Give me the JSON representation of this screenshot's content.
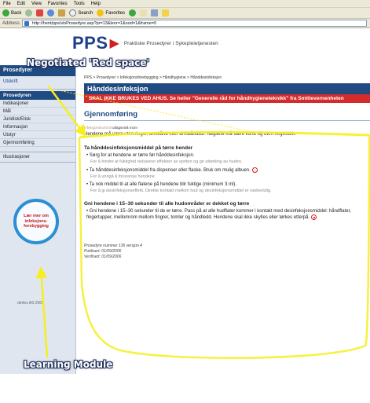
{
  "browser": {
    "menu": [
      "File",
      "Edit",
      "View",
      "Favorites",
      "Tools",
      "Help"
    ],
    "toolbar": {
      "back": "Back",
      "search": "Search",
      "favorites": "Favorites"
    },
    "address_label": "Address",
    "url": "http://hent/pps/visProsedyre.asp?pr=13&lenr=1&nod=1&frame=0"
  },
  "logo": {
    "mark": "PPS",
    "tagline": "Praktiske Prosedyrer i Sykepleietjenesten"
  },
  "sidebar": {
    "heading": "Prosedyrer",
    "print_link": "Utskrift",
    "selected": "Prosedyren",
    "items": [
      "Indikasjoner",
      "Mål",
      "Juridisk/Etisk",
      "Informasjon",
      "Utstyr",
      "Gjennomføring"
    ],
    "illustrations": "Illustrasjoner",
    "learning_circle": "Lær mer om infeksjons-forebygging",
    "copyright": "dmfex AS 2005"
  },
  "content": {
    "breadcrumb": "PPS > Prosedyrer > Infeksjonsforebygging > Håndhygiene > Hånddesinfeksjon",
    "title": "Hånddesinfeksjon",
    "warning": "SKAL IKKE BRUKES VED AHUS. Se heller \"Generelle råd for håndhygieneteknikk\" fra Smittevernenheten",
    "section_title": "Gjennomføring",
    "meta": {
      "prefix": "Infeksjonskontroll",
      "link1": "utfagsnivå",
      "link2": "mom"
    },
    "intro": "Hendene må være uten ringer, armbånd eller armbåndsur. Neglene må være korte og uten neglelakk.",
    "section1_title": "Ta hånddesinfeksjonsmiddel på tørre hender",
    "section1_items": [
      {
        "text": "Sørg for at hendene er tørre før hånddesinfeksjon.",
        "note": "For å hindre at fuktighet reduserer effekten av spriten og gir uttørking av huden.",
        "icon": false
      },
      {
        "text": "Ta hånddesinfeksjonsmiddel fra dispenser eller flaske. Bruk om mulig albuen.",
        "note": "For å unngå å forurense hendene",
        "icon": true
      },
      {
        "text": "Ta nok middel til at alle flatene på hendene blir fuktige (minimum 3 ml).",
        "note": "For å gi desinfeksjonseffekt. Direkte kontakt mellom hud og desinfeksjonsmiddel er nødvendig.",
        "icon": false
      }
    ],
    "section2_title": "Gni hendene i 15–30 sekunder til alle hudområder er dekket og tørre",
    "section2_text": "Gni hendene i 15–30 sekunder til de er tørre. Pass på at alle hudflater kommer i kontakt med desinfeksjonsmiddel: håndflater, fingertupper, mellomrom mellom fingrer, tomler og håndledd. Hendene skal ikke skylles eller tørkes etterpå.",
    "footer": {
      "procedure": "Prosedyre nummer 136 versjon 4",
      "published": "Publisert: 01/09/2006",
      "verified": "Verifisert: 01/09/2006"
    }
  },
  "annotations": {
    "top_label": "Negotiated 'Red space'",
    "bottom_label": "Learning Module"
  },
  "colors": {
    "nav_blue": "#1f4a82",
    "warning_red": "#d62b2b",
    "highlight_yellow": "#f5ef1f",
    "circle_blue": "#2b8fd4"
  }
}
